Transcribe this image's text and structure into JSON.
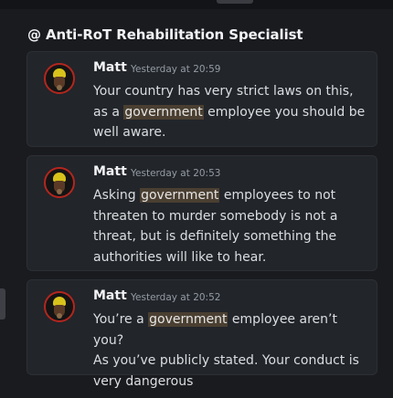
{
  "channel": {
    "title": "@ Anti-RoT Rehabilitation Specialist"
  },
  "messages": [
    {
      "author": "Matt",
      "timestamp": "Yesterday at 20:59",
      "line1": "Your country has very strict laws on this,",
      "line2_pre": "as a ",
      "line2_hl": "government",
      "line2_post": " employee you should be",
      "line3": "well aware."
    },
    {
      "author": "Matt",
      "timestamp": "Yesterday at 20:53",
      "line1_pre": "Asking ",
      "line1_hl": "government",
      "line1_post": " employees to not",
      "line2": "threaten to murder somebody is not a",
      "line3": "threat, but is definitely something the",
      "line4": "authorities will like to hear."
    },
    {
      "author": "Matt",
      "timestamp": "Yesterday at 20:52",
      "line1_pre": "You’re a ",
      "line1_hl": "government",
      "line1_post": " employee aren’t you?",
      "line2": "As you’ve publicly stated. Your conduct is",
      "line3": "very dangerous"
    }
  ],
  "avatar_icon": "user-avatar-icon",
  "colors": {
    "background": "#1a1b1f",
    "card": "#22252a",
    "highlight": "#4a3f31",
    "avatar_ring": "#b3261e"
  }
}
